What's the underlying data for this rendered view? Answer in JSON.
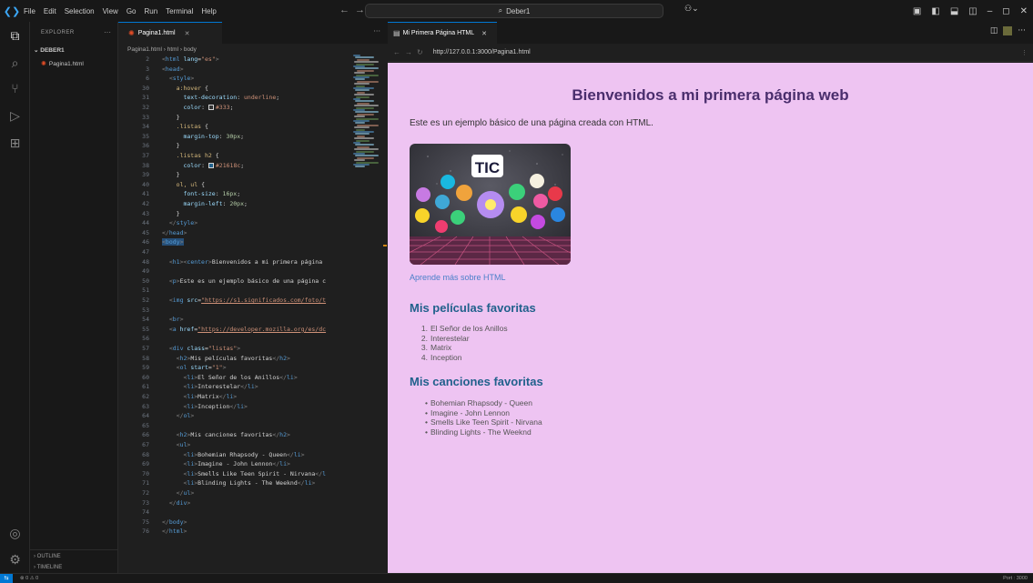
{
  "titlebar": {
    "menu": [
      "File",
      "Edit",
      "Selection",
      "View",
      "Go",
      "Run",
      "Terminal",
      "Help"
    ],
    "search": "Deber1"
  },
  "sidebar": {
    "header": "EXPLORER",
    "folder": "DEBER1",
    "file": "Pagina1.html",
    "outline": "OUTLINE",
    "timeline": "TIMELINE"
  },
  "editor": {
    "tab": "Pagina1.html",
    "breadcrumb": [
      "Pagina1.html",
      "html",
      "body"
    ],
    "lines": [
      {
        "n": "2",
        "html": "<span class=\"tb\">&lt;</span><span class=\"t\">html</span> <span class=\"at\">lang</span><span class=\"txt\">=</span><span class=\"sv\">\"es\"</span><span class=\"tb\">&gt;</span>"
      },
      {
        "n": "3",
        "html": "<span class=\"tb\">&lt;</span><span class=\"t\">head</span><span class=\"tb\">&gt;</span>"
      },
      {
        "n": "6",
        "html": "  <span class=\"tb\">&lt;</span><span class=\"t\">style</span><span class=\"tb\">&gt;</span>"
      },
      {
        "n": "30",
        "html": "    <span class=\"sel\">a:hover</span> <span class=\"txt\">{</span>"
      },
      {
        "n": "31",
        "html": "      <span class=\"pr\">text-decoration</span><span class=\"txt\">: </span><span class=\"sv\">underline</span><span class=\"txt\">;</span>"
      },
      {
        "n": "32",
        "html": "      <span class=\"pr\">color</span><span class=\"txt\">: </span><span class=\"swatch\" style=\"background:#333333\"></span><span class=\"sv\">#333</span><span class=\"txt\">;</span>"
      },
      {
        "n": "33",
        "html": "    <span class=\"txt\">}</span>"
      },
      {
        "n": "34",
        "html": "    <span class=\"sel\">.listas</span> <span class=\"txt\">{</span>"
      },
      {
        "n": "35",
        "html": "      <span class=\"pr\">margin-top</span><span class=\"txt\">: </span><span class=\"num\">30px</span><span class=\"txt\">;</span>"
      },
      {
        "n": "36",
        "html": "    <span class=\"txt\">}</span>"
      },
      {
        "n": "37",
        "html": "    <span class=\"sel\">.listas h2</span> <span class=\"txt\">{</span>"
      },
      {
        "n": "38",
        "html": "      <span class=\"pr\">color</span><span class=\"txt\">: </span><span class=\"swatch\" style=\"background:#21618c\"></span><span class=\"sv\">#21618c</span><span class=\"txt\">;</span>"
      },
      {
        "n": "39",
        "html": "    <span class=\"txt\">}</span>"
      },
      {
        "n": "40",
        "html": "    <span class=\"sel\">ol, ul</span> <span class=\"txt\">{</span>"
      },
      {
        "n": "41",
        "html": "      <span class=\"pr\">font-size</span><span class=\"txt\">: </span><span class=\"num\">16px</span><span class=\"txt\">;</span>"
      },
      {
        "n": "42",
        "html": "      <span class=\"pr\">margin-left</span><span class=\"txt\">: </span><span class=\"num\">20px</span><span class=\"txt\">;</span>"
      },
      {
        "n": "43",
        "html": "    <span class=\"txt\">}</span>"
      },
      {
        "n": "44",
        "html": "  <span class=\"tb\">&lt;/</span><span class=\"t\">style</span><span class=\"tb\">&gt;</span>"
      },
      {
        "n": "45",
        "html": "<span class=\"tb\">&lt;/</span><span class=\"t\">head</span><span class=\"tb\">&gt;</span>"
      },
      {
        "n": "46",
        "html": "<span class=\"tb\">&lt;</span><span class=\"t\">body</span><span class=\"tb\">&gt;</span>",
        "active": true
      },
      {
        "n": "47",
        "html": ""
      },
      {
        "n": "48",
        "html": "  <span class=\"tb\">&lt;</span><span class=\"t\">h1</span><span class=\"tb\">&gt;&lt;</span><span class=\"t\">center</span><span class=\"tb\">&gt;</span><span class=\"txt\">Bienvenidos a mi primera página</span>"
      },
      {
        "n": "49",
        "html": ""
      },
      {
        "n": "50",
        "html": "  <span class=\"tb\">&lt;</span><span class=\"t\">p</span><span class=\"tb\">&gt;</span><span class=\"txt\">Este es un ejemplo básico de una página c</span>"
      },
      {
        "n": "51",
        "html": ""
      },
      {
        "n": "52",
        "html": "  <span class=\"tb\">&lt;</span><span class=\"t\">img</span> <span class=\"at\">src</span><span class=\"txt\">=</span><span class=\"sv\" style=\"text-decoration:underline\">\"https://s1.significados.com/foto/t</span>"
      },
      {
        "n": "53",
        "html": ""
      },
      {
        "n": "54",
        "html": "  <span class=\"tb\">&lt;</span><span class=\"t\">br</span><span class=\"tb\">&gt;</span>"
      },
      {
        "n": "55",
        "html": "  <span class=\"tb\">&lt;</span><span class=\"t\">a</span> <span class=\"at\">href</span><span class=\"txt\">=</span><span class=\"sv\" style=\"text-decoration:underline\">\"https://developer.mozilla.org/es/dc</span>"
      },
      {
        "n": "56",
        "html": ""
      },
      {
        "n": "57",
        "html": "  <span class=\"tb\">&lt;</span><span class=\"t\">div</span> <span class=\"at\">class</span><span class=\"txt\">=</span><span class=\"sv\">\"listas\"</span><span class=\"tb\">&gt;</span>"
      },
      {
        "n": "58",
        "html": "    <span class=\"tb\">&lt;</span><span class=\"t\">h2</span><span class=\"tb\">&gt;</span><span class=\"txt\">Mis películas favoritas</span><span class=\"tb\">&lt;/</span><span class=\"t\">h2</span><span class=\"tb\">&gt;</span>"
      },
      {
        "n": "59",
        "html": "    <span class=\"tb\">&lt;</span><span class=\"t\">ol</span> <span class=\"at\">start</span><span class=\"txt\">=</span><span class=\"sv\">\"1\"</span><span class=\"tb\">&gt;</span>"
      },
      {
        "n": "60",
        "html": "      <span class=\"tb\">&lt;</span><span class=\"t\">li</span><span class=\"tb\">&gt;</span><span class=\"txt\">El Señor de los Anillos</span><span class=\"tb\">&lt;/</span><span class=\"t\">li</span><span class=\"tb\">&gt;</span>"
      },
      {
        "n": "61",
        "html": "      <span class=\"tb\">&lt;</span><span class=\"t\">li</span><span class=\"tb\">&gt;</span><span class=\"txt\">Interestelar</span><span class=\"tb\">&lt;/</span><span class=\"t\">li</span><span class=\"tb\">&gt;</span>"
      },
      {
        "n": "62",
        "html": "      <span class=\"tb\">&lt;</span><span class=\"t\">li</span><span class=\"tb\">&gt;</span><span class=\"txt\">Matrix</span><span class=\"tb\">&lt;/</span><span class=\"t\">li</span><span class=\"tb\">&gt;</span>"
      },
      {
        "n": "63",
        "html": "      <span class=\"tb\">&lt;</span><span class=\"t\">li</span><span class=\"tb\">&gt;</span><span class=\"txt\">Inception</span><span class=\"tb\">&lt;/</span><span class=\"t\">li</span><span class=\"tb\">&gt;</span>"
      },
      {
        "n": "64",
        "html": "    <span class=\"tb\">&lt;/</span><span class=\"t\">ol</span><span class=\"tb\">&gt;</span>"
      },
      {
        "n": "65",
        "html": ""
      },
      {
        "n": "66",
        "html": "    <span class=\"tb\">&lt;</span><span class=\"t\">h2</span><span class=\"tb\">&gt;</span><span class=\"txt\">Mis canciones favoritas</span><span class=\"tb\">&lt;/</span><span class=\"t\">h2</span><span class=\"tb\">&gt;</span>"
      },
      {
        "n": "67",
        "html": "    <span class=\"tb\">&lt;</span><span class=\"t\">ul</span><span class=\"tb\">&gt;</span>"
      },
      {
        "n": "68",
        "html": "      <span class=\"tb\">&lt;</span><span class=\"t\">li</span><span class=\"tb\">&gt;</span><span class=\"txt\">Bohemian Rhapsody - Queen</span><span class=\"tb\">&lt;/</span><span class=\"t\">li</span><span class=\"tb\">&gt;</span>"
      },
      {
        "n": "69",
        "html": "      <span class=\"tb\">&lt;</span><span class=\"t\">li</span><span class=\"tb\">&gt;</span><span class=\"txt\">Imagine - John Lennon</span><span class=\"tb\">&lt;/</span><span class=\"t\">li</span><span class=\"tb\">&gt;</span>"
      },
      {
        "n": "70",
        "html": "      <span class=\"tb\">&lt;</span><span class=\"t\">li</span><span class=\"tb\">&gt;</span><span class=\"txt\">Smells Like Teen Spirit - Nirvana</span><span class=\"tb\">&lt;/</span><span class=\"t\">l</span>"
      },
      {
        "n": "71",
        "html": "      <span class=\"tb\">&lt;</span><span class=\"t\">li</span><span class=\"tb\">&gt;</span><span class=\"txt\">Blinding Lights - The Weeknd</span><span class=\"tb\">&lt;/</span><span class=\"t\">li</span><span class=\"tb\">&gt;</span>"
      },
      {
        "n": "72",
        "html": "    <span class=\"tb\">&lt;/</span><span class=\"t\">ul</span><span class=\"tb\">&gt;</span>"
      },
      {
        "n": "73",
        "html": "  <span class=\"tb\">&lt;/</span><span class=\"t\">div</span><span class=\"tb\">&gt;</span>"
      },
      {
        "n": "74",
        "html": ""
      },
      {
        "n": "75",
        "html": "<span class=\"tb\">&lt;/</span><span class=\"t\">body</span><span class=\"tb\">&gt;</span>"
      },
      {
        "n": "76",
        "html": "<span class=\"tb\">&lt;/</span><span class=\"t\">html</span><span class=\"tb\">&gt;</span>"
      }
    ]
  },
  "browser": {
    "tab": "Mi Primera Página HTML",
    "url": "http://127.0.0.1:3000/Pagina1.html"
  },
  "webpage": {
    "title": "Bienvenidos a mi primera página web",
    "intro": "Este es un ejemplo básico de una página creada con HTML.",
    "image_text": "TIC",
    "link": "Aprende más sobre HTML",
    "movies_heading": "Mis películas favoritas",
    "movies": [
      "El Señor de los Anillos",
      "Interestelar",
      "Matrix",
      "Inception"
    ],
    "songs_heading": "Mis canciones favoritas",
    "songs": [
      "Bohemian Rhapsody - Queen",
      "Imagine - John Lennon",
      "Smells Like Teen Spirit - Nirvana",
      "Blinding Lights - The Weeknd"
    ]
  },
  "statusbar": {
    "errors": "⊗ 0 ⚠ 0",
    "port": "Port : 3000"
  },
  "colors": {
    "accent": "#0078d4",
    "page_background": "#eec4f2",
    "heading2": "#21618c"
  }
}
